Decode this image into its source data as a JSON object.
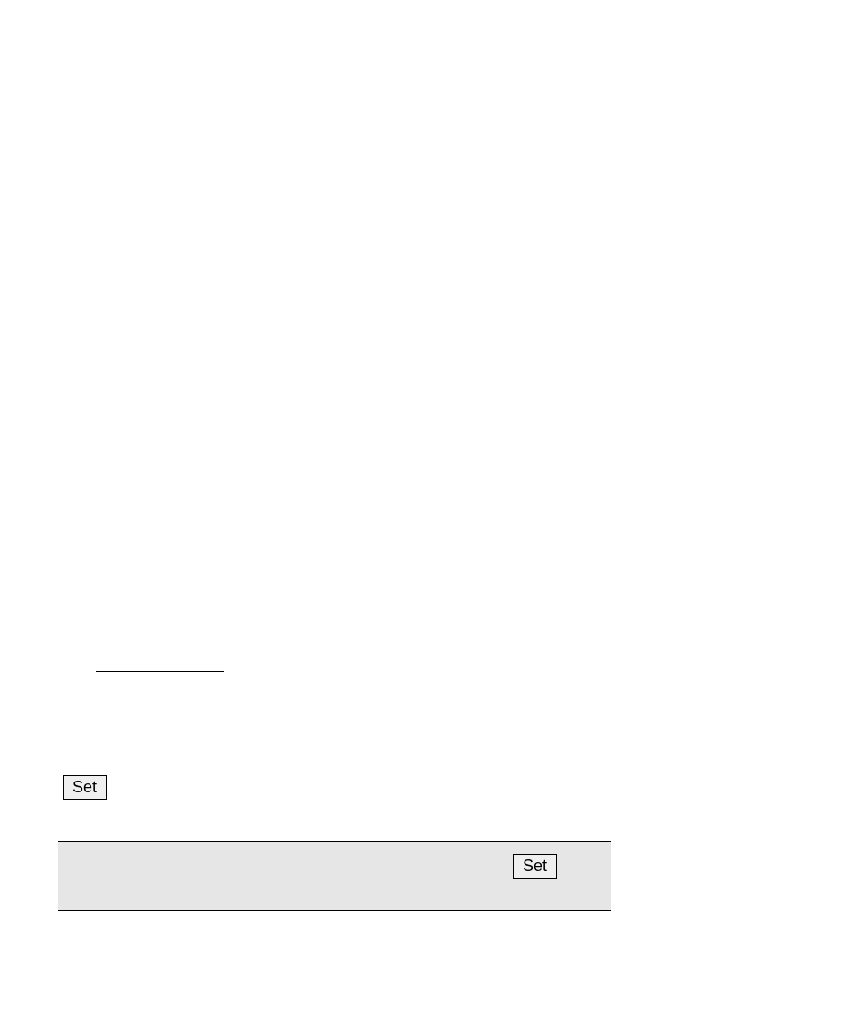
{
  "buttons": {
    "set1": "Set",
    "set2": "Set"
  }
}
